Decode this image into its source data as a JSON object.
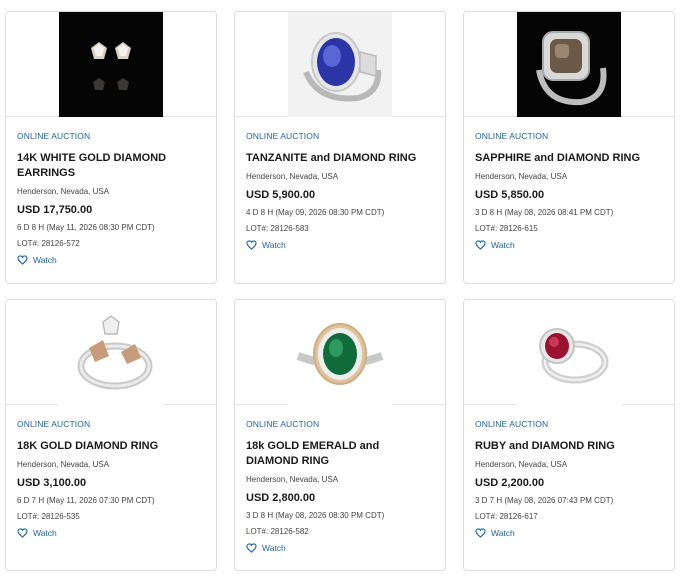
{
  "listings": [
    {
      "type": "ONLINE AUCTION",
      "title": "14K WHITE GOLD DIAMOND EARRINGS",
      "location": "Henderson, Nevada, USA",
      "price": "USD 17,750.00",
      "time_left": "6 D 8 H (May 11, 2026 08:30 PM CDT)",
      "lot": "LOT#: 28126-572",
      "watch_label": "Watch",
      "image_icon": "diamond-earrings-image"
    },
    {
      "type": "ONLINE AUCTION",
      "title": "TANZANITE and DIAMOND RING",
      "location": "Henderson, Nevada, USA",
      "price": "USD 5,900.00",
      "time_left": "4 D 8 H (May 09, 2026 08:30 PM CDT)",
      "lot": "LOT#: 28126-583",
      "watch_label": "Watch",
      "image_icon": "tanzanite-ring-image"
    },
    {
      "type": "ONLINE AUCTION",
      "title": "SAPPHIRE and DIAMOND RING",
      "location": "Henderson, Nevada, USA",
      "price": "USD 5,850.00",
      "time_left": "3 D 8 H (May 08, 2026 08:41 PM CDT)",
      "lot": "LOT#: 28126-615",
      "watch_label": "Watch",
      "image_icon": "sapphire-ring-image"
    },
    {
      "type": "ONLINE AUCTION",
      "title": "18K GOLD DIAMOND RING",
      "location": "Henderson, Nevada, USA",
      "price": "USD 3,100.00",
      "time_left": "6 D 7 H (May 11, 2026 07:30 PM CDT)",
      "lot": "LOT#: 28126-535",
      "watch_label": "Watch",
      "image_icon": "gold-diamond-ring-image"
    },
    {
      "type": "ONLINE AUCTION",
      "title": "18k GOLD EMERALD and DIAMOND RING",
      "location": "Henderson, Nevada, USA",
      "price": "USD 2,800.00",
      "time_left": "3 D 8 H (May 08, 2026 08:30 PM CDT)",
      "lot": "LOT#: 28126-582",
      "watch_label": "Watch",
      "image_icon": "emerald-ring-image"
    },
    {
      "type": "ONLINE AUCTION",
      "title": "RUBY and DIAMOND RING",
      "location": "Henderson, Nevada, USA",
      "price": "USD 2,200.00",
      "time_left": "3 D 7 H (May 08, 2026 07:43 PM CDT)",
      "lot": "LOT#: 28126-617",
      "watch_label": "Watch",
      "image_icon": "ruby-ring-image"
    }
  ],
  "colors": {
    "link_blue": "#1f63a8",
    "border": "#dcdcdc",
    "tanzanite": "#2b35a6",
    "sapphire": "#6b5a47",
    "emerald": "#0f6b3a",
    "ruby": "#9b1230"
  }
}
